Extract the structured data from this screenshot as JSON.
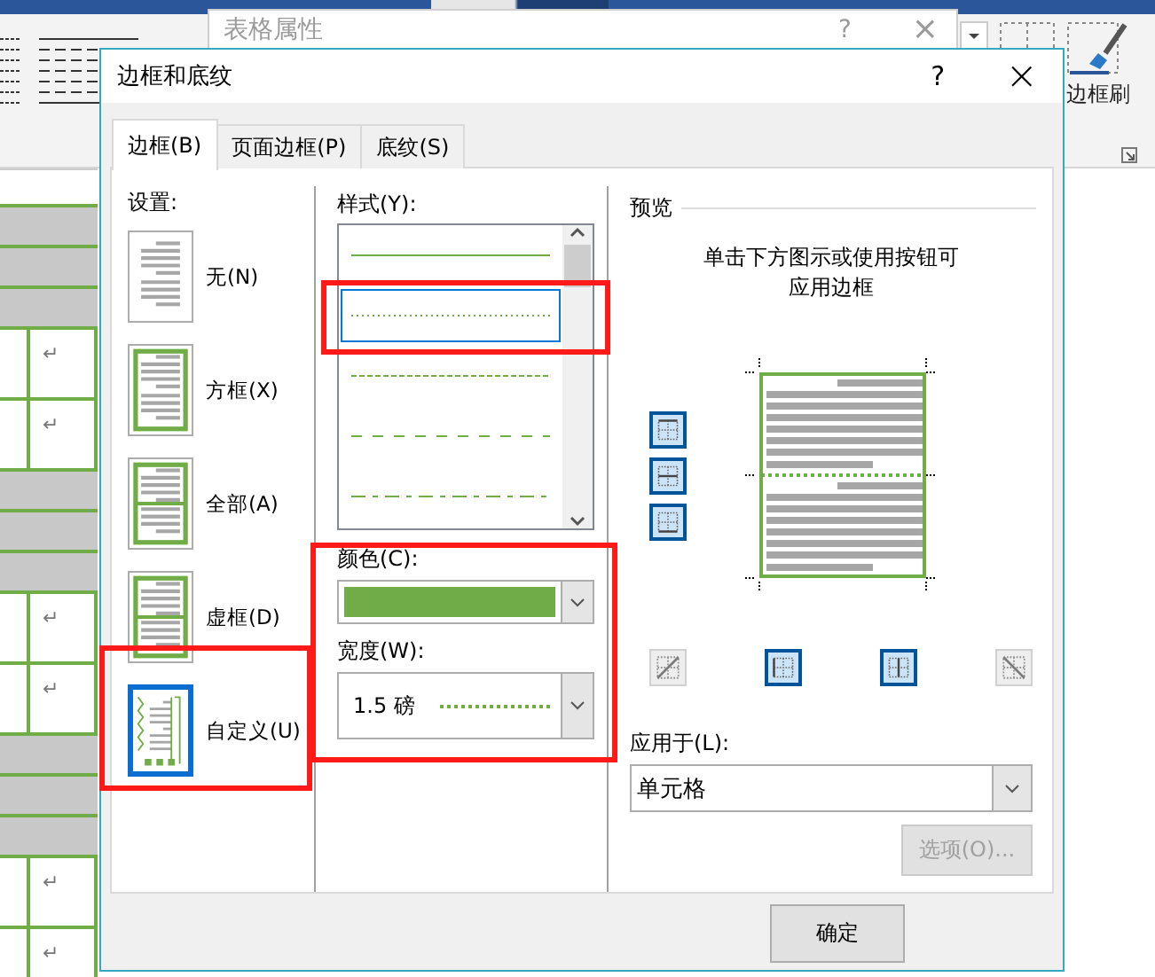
{
  "word": {
    "ribbon_label": "边框刷",
    "table": {
      "rows": [
        {
          "kind": "shaded"
        },
        {
          "kind": "shaded"
        },
        {
          "kind": "shaded"
        },
        {
          "kind": "cells",
          "mark": "↵"
        },
        {
          "kind": "cells",
          "mark": "↵"
        },
        {
          "kind": "shaded"
        },
        {
          "kind": "shaded"
        },
        {
          "kind": "shaded"
        },
        {
          "kind": "cells",
          "mark": "↵"
        },
        {
          "kind": "cells",
          "mark": "↵"
        },
        {
          "kind": "shaded"
        },
        {
          "kind": "shaded"
        },
        {
          "kind": "shaded"
        },
        {
          "kind": "cells",
          "mark": "↵"
        },
        {
          "kind": "cells",
          "mark": "↵"
        }
      ]
    }
  },
  "table_properties": {
    "title": "表格属性",
    "help": "?",
    "close": "×"
  },
  "dialog": {
    "title": "边框和底纹",
    "help": "?",
    "close": "×",
    "tabs": [
      {
        "label": "边框(B)",
        "selected": true
      },
      {
        "label": "页面边框(P)",
        "selected": false
      },
      {
        "label": "底纹(S)",
        "selected": false
      }
    ],
    "settings": {
      "label": "设置:",
      "items": [
        {
          "label": "无(N)",
          "kind": "none",
          "selected": false
        },
        {
          "label": "方框(X)",
          "kind": "box",
          "selected": false
        },
        {
          "label": "全部(A)",
          "kind": "all",
          "selected": false
        },
        {
          "label": "虚框(D)",
          "kind": "grid",
          "selected": false
        },
        {
          "label": "自定义(U)",
          "kind": "custom",
          "selected": true
        }
      ]
    },
    "style": {
      "label": "样式(Y):",
      "styles": [
        {
          "kind": "solid",
          "selected": false
        },
        {
          "kind": "dotted",
          "selected": true
        },
        {
          "kind": "dashed",
          "selected": false
        },
        {
          "kind": "dashed-wide",
          "selected": false
        },
        {
          "kind": "dash-dot",
          "selected": false
        }
      ],
      "color_label": "颜色(C):",
      "color": "#70ad47",
      "width_label": "宽度(W):",
      "width": "1.5 磅"
    },
    "preview": {
      "title": "预览",
      "hint": "单击下方图示或使用按钮可应用边框",
      "side_buttons": [
        {
          "kind": "top",
          "on": true
        },
        {
          "kind": "middle",
          "on": true
        },
        {
          "kind": "bottom",
          "on": true
        }
      ],
      "bottom_buttons": [
        {
          "kind": "diagonal-up",
          "on": false
        },
        {
          "kind": "left",
          "on": true
        },
        {
          "kind": "center",
          "on": true
        },
        {
          "kind": "diagonal-down",
          "on": false
        }
      ]
    },
    "apply_to": {
      "label": "应用于(L):",
      "value": "单元格"
    },
    "options_button": {
      "label": "选项(O)...",
      "disabled": true
    },
    "ok_button": "确定"
  }
}
